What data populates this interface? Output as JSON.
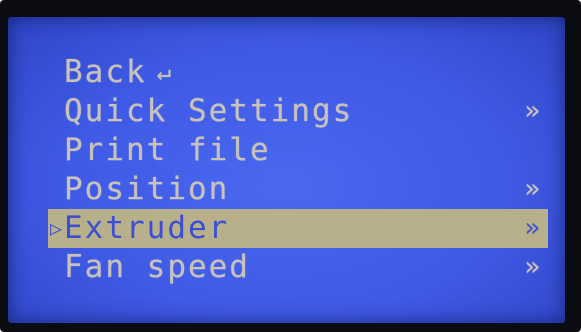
{
  "screen": {
    "background_color": "#4460ea",
    "text_color": "#c8c2b8",
    "highlight_color": "#b7b08a"
  },
  "menu": {
    "items": [
      {
        "label": "Back",
        "trailing": "↵",
        "selected": false
      },
      {
        "label": "Quick Settings",
        "trailing": "»",
        "selected": false
      },
      {
        "label": "Print file",
        "trailing": "",
        "selected": false
      },
      {
        "label": "Position",
        "trailing": "»",
        "selected": false
      },
      {
        "label": "Extruder",
        "trailing": "»",
        "selected": true
      },
      {
        "label": "Fan speed",
        "trailing": "»",
        "selected": false
      }
    ],
    "cursor_glyph": "▷"
  }
}
